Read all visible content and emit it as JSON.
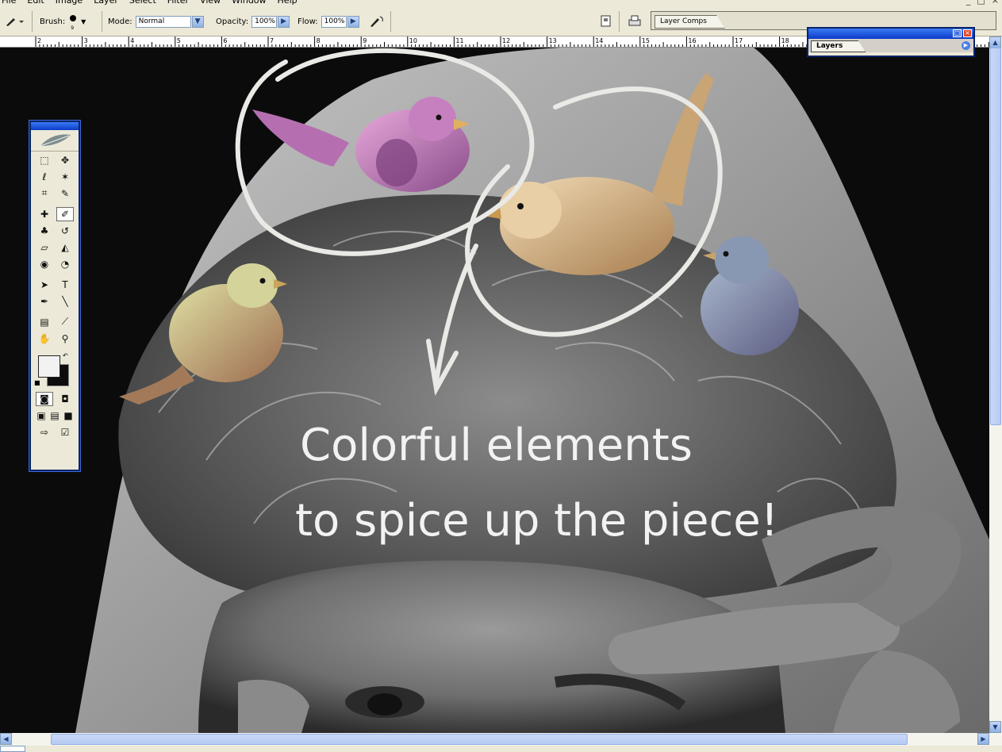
{
  "menubar": {
    "items": [
      "File",
      "Edit",
      "Image",
      "Layer",
      "Select",
      "Filter",
      "View",
      "Window",
      "Help"
    ],
    "window_controls": [
      "_",
      "□",
      "×"
    ]
  },
  "options_bar": {
    "brush_label": "Brush:",
    "brush_size": "9",
    "mode_label": "Mode:",
    "mode_value": "Normal",
    "opacity_label": "Opacity:",
    "opacity_value": "100%",
    "flow_label": "Flow:",
    "flow_value": "100%"
  },
  "palette_well": {
    "tab": "Layer Comps"
  },
  "ruler": {
    "ticks": [
      "2",
      "3",
      "4",
      "5",
      "6",
      "7",
      "8",
      "9",
      "10",
      "11",
      "12",
      "13",
      "14",
      "15",
      "16",
      "17",
      "18"
    ]
  },
  "canvas": {
    "annotation_line1": "Colorful elements",
    "annotation_line2": "to spice up the piece!"
  },
  "toolbox": {
    "tools": [
      [
        "marquee-tool",
        "move-tool"
      ],
      [
        "lasso-tool",
        "magic-wand-tool"
      ],
      [
        "crop-tool",
        "slice-tool"
      ],
      [
        "healing-brush-tool",
        "brush-tool"
      ],
      [
        "clone-stamp-tool",
        "history-brush-tool"
      ],
      [
        "eraser-tool",
        "paint-bucket-tool"
      ],
      [
        "blur-tool",
        "dodge-tool"
      ],
      [
        "path-selection-tool",
        "type-tool"
      ],
      [
        "pen-tool",
        "line-tool"
      ],
      [
        "notes-tool",
        "eyedropper-tool"
      ],
      [
        "hand-tool",
        "zoom-tool"
      ]
    ],
    "active_tool": "brush-tool",
    "foreground_color": "#f2f2f2",
    "background_color": "#0d0d0d"
  },
  "layers_palette": {
    "tab": "Layers"
  },
  "colors": {
    "chrome": "#ece9d8",
    "titlebar_blue": "#0a3bc8",
    "close_red": "#e24a2b",
    "bird_pink": "#c27ab8",
    "bird_tan": "#d7b78b",
    "bird_green": "#c9c08a",
    "bird_blue": "#7f8fa8"
  }
}
